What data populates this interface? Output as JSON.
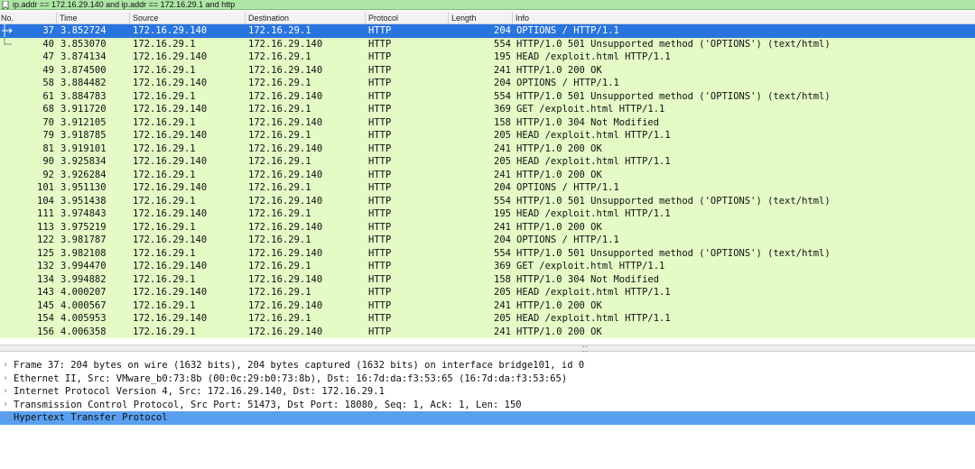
{
  "filter": {
    "text": "ip.addr == 172.16.29.140 and ip.addr == 172.16.29.1 and http"
  },
  "columns": [
    "No.",
    "Time",
    "Source",
    "Destination",
    "Protocol",
    "Length",
    "Info"
  ],
  "packets": [
    {
      "no": "37",
      "time": "3.852724",
      "src": "172.16.29.140",
      "dst": "172.16.29.1",
      "proto": "HTTP",
      "len": "204",
      "info": "OPTIONS / HTTP/1.1",
      "selected": true
    },
    {
      "no": "40",
      "time": "3.853070",
      "src": "172.16.29.1",
      "dst": "172.16.29.140",
      "proto": "HTTP",
      "len": "554",
      "info": "HTTP/1.0 501 Unsupported method ('OPTIONS')  (text/html)"
    },
    {
      "no": "47",
      "time": "3.874134",
      "src": "172.16.29.140",
      "dst": "172.16.29.1",
      "proto": "HTTP",
      "len": "195",
      "info": "HEAD /exploit.html HTTP/1.1"
    },
    {
      "no": "49",
      "time": "3.874500",
      "src": "172.16.29.1",
      "dst": "172.16.29.140",
      "proto": "HTTP",
      "len": "241",
      "info": "HTTP/1.0 200 OK"
    },
    {
      "no": "58",
      "time": "3.884482",
      "src": "172.16.29.140",
      "dst": "172.16.29.1",
      "proto": "HTTP",
      "len": "204",
      "info": "OPTIONS / HTTP/1.1"
    },
    {
      "no": "61",
      "time": "3.884783",
      "src": "172.16.29.1",
      "dst": "172.16.29.140",
      "proto": "HTTP",
      "len": "554",
      "info": "HTTP/1.0 501 Unsupported method ('OPTIONS')  (text/html)"
    },
    {
      "no": "68",
      "time": "3.911720",
      "src": "172.16.29.140",
      "dst": "172.16.29.1",
      "proto": "HTTP",
      "len": "369",
      "info": "GET /exploit.html HTTP/1.1"
    },
    {
      "no": "70",
      "time": "3.912105",
      "src": "172.16.29.1",
      "dst": "172.16.29.140",
      "proto": "HTTP",
      "len": "158",
      "info": "HTTP/1.0 304 Not Modified"
    },
    {
      "no": "79",
      "time": "3.918785",
      "src": "172.16.29.140",
      "dst": "172.16.29.1",
      "proto": "HTTP",
      "len": "205",
      "info": "HEAD /exploit.html HTTP/1.1"
    },
    {
      "no": "81",
      "time": "3.919101",
      "src": "172.16.29.1",
      "dst": "172.16.29.140",
      "proto": "HTTP",
      "len": "241",
      "info": "HTTP/1.0 200 OK"
    },
    {
      "no": "90",
      "time": "3.925834",
      "src": "172.16.29.140",
      "dst": "172.16.29.1",
      "proto": "HTTP",
      "len": "205",
      "info": "HEAD /exploit.html HTTP/1.1"
    },
    {
      "no": "92",
      "time": "3.926284",
      "src": "172.16.29.1",
      "dst": "172.16.29.140",
      "proto": "HTTP",
      "len": "241",
      "info": "HTTP/1.0 200 OK"
    },
    {
      "no": "101",
      "time": "3.951130",
      "src": "172.16.29.140",
      "dst": "172.16.29.1",
      "proto": "HTTP",
      "len": "204",
      "info": "OPTIONS / HTTP/1.1"
    },
    {
      "no": "104",
      "time": "3.951438",
      "src": "172.16.29.1",
      "dst": "172.16.29.140",
      "proto": "HTTP",
      "len": "554",
      "info": "HTTP/1.0 501 Unsupported method ('OPTIONS')  (text/html)"
    },
    {
      "no": "111",
      "time": "3.974843",
      "src": "172.16.29.140",
      "dst": "172.16.29.1",
      "proto": "HTTP",
      "len": "195",
      "info": "HEAD /exploit.html HTTP/1.1"
    },
    {
      "no": "113",
      "time": "3.975219",
      "src": "172.16.29.1",
      "dst": "172.16.29.140",
      "proto": "HTTP",
      "len": "241",
      "info": "HTTP/1.0 200 OK"
    },
    {
      "no": "122",
      "time": "3.981787",
      "src": "172.16.29.140",
      "dst": "172.16.29.1",
      "proto": "HTTP",
      "len": "204",
      "info": "OPTIONS / HTTP/1.1"
    },
    {
      "no": "125",
      "time": "3.982108",
      "src": "172.16.29.1",
      "dst": "172.16.29.140",
      "proto": "HTTP",
      "len": "554",
      "info": "HTTP/1.0 501 Unsupported method ('OPTIONS')  (text/html)"
    },
    {
      "no": "132",
      "time": "3.994470",
      "src": "172.16.29.140",
      "dst": "172.16.29.1",
      "proto": "HTTP",
      "len": "369",
      "info": "GET /exploit.html HTTP/1.1"
    },
    {
      "no": "134",
      "time": "3.994882",
      "src": "172.16.29.1",
      "dst": "172.16.29.140",
      "proto": "HTTP",
      "len": "158",
      "info": "HTTP/1.0 304 Not Modified"
    },
    {
      "no": "143",
      "time": "4.000207",
      "src": "172.16.29.140",
      "dst": "172.16.29.1",
      "proto": "HTTP",
      "len": "205",
      "info": "HEAD /exploit.html HTTP/1.1"
    },
    {
      "no": "145",
      "time": "4.000567",
      "src": "172.16.29.1",
      "dst": "172.16.29.140",
      "proto": "HTTP",
      "len": "241",
      "info": "HTTP/1.0 200 OK"
    },
    {
      "no": "154",
      "time": "4.005953",
      "src": "172.16.29.140",
      "dst": "172.16.29.1",
      "proto": "HTTP",
      "len": "205",
      "info": "HEAD /exploit.html HTTP/1.1"
    },
    {
      "no": "156",
      "time": "4.006358",
      "src": "172.16.29.1",
      "dst": "172.16.29.140",
      "proto": "HTTP",
      "len": "241",
      "info": "HTTP/1.0 200 OK"
    }
  ],
  "details": [
    {
      "text": "Frame 37: 204 bytes on wire (1632 bits), 204 bytes captured (1632 bits) on interface bridge101, id 0"
    },
    {
      "text": "Ethernet II, Src: VMware_b0:73:8b (00:0c:29:b0:73:8b), Dst: 16:7d:da:f3:53:65 (16:7d:da:f3:53:65)"
    },
    {
      "text": "Internet Protocol Version 4, Src: 172.16.29.140, Dst: 172.16.29.1"
    },
    {
      "text": "Transmission Control Protocol, Src Port: 51473, Dst Port: 18080, Seq: 1, Ack: 1, Len: 150"
    },
    {
      "text": "Hypertext Transfer Protocol",
      "selected": true
    }
  ],
  "colors": {
    "filter_bg": "#aee6a6",
    "row_bg": "#e4fbc6",
    "selected_row": "#2874e0",
    "selected_detail": "#5aa0f0"
  },
  "icons": {
    "filter_bookmark": "bookmark-icon",
    "request_arrow": "request-arrow-icon",
    "expand": "chevron-right-icon"
  }
}
